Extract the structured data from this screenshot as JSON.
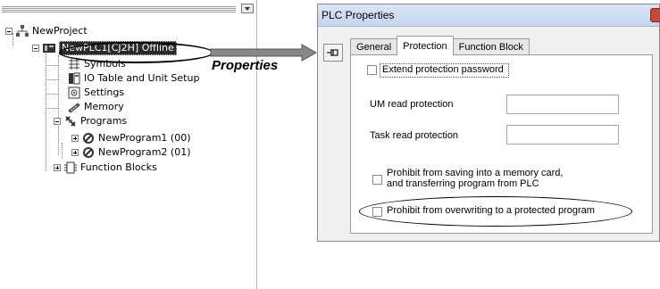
{
  "tree": {
    "project_label": "NewProject",
    "plc_label": "NewPLC1[CJ2H] Offline",
    "items": [
      {
        "label": "Symbols",
        "icon": "symbols-icon"
      },
      {
        "label": "IO Table and Unit Setup",
        "icon": "io-table-icon"
      },
      {
        "label": "Settings",
        "icon": "settings-icon"
      },
      {
        "label": "Memory",
        "icon": "memory-icon"
      },
      {
        "label": "Programs",
        "icon": "programs-icon"
      },
      {
        "label": "NewProgram1 (00)",
        "icon": "program-icon"
      },
      {
        "label": "NewProgram2 (01)",
        "icon": "program-icon"
      },
      {
        "label": "Function Blocks",
        "icon": "function-blocks-icon"
      }
    ]
  },
  "callout": {
    "label": "Properties"
  },
  "dialog": {
    "title": "PLC Properties",
    "tabs": [
      "General",
      "Protection",
      "Function Block"
    ],
    "active_tab": "Protection",
    "extend_password_label": "Extend protection password",
    "um_read_label": "UM read protection",
    "task_read_label": "Task read protection",
    "um_read_value": "",
    "task_read_value": "",
    "prohibit_memory_card_line1": "Prohibit from saving into a memory card,",
    "prohibit_memory_card_line2": "and transferring program from PLC",
    "prohibit_overwrite_label": "Prohibit from overwriting to a protected program",
    "checkboxes": {
      "extend_password": false,
      "prohibit_memory_card": false,
      "prohibit_overwrite": false
    }
  },
  "colors": {
    "selected_node_bg": "#2a2a2a",
    "titlebar": "#c3d5ee",
    "close_button": "#c8473a"
  }
}
